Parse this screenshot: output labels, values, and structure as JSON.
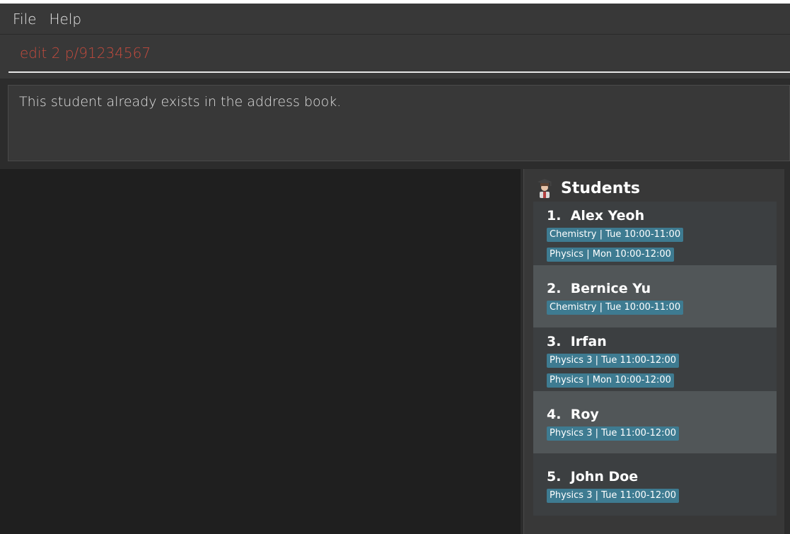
{
  "menu": {
    "items": [
      "File",
      "Help"
    ]
  },
  "command": {
    "value": "edit 2 p/91234567"
  },
  "result": {
    "message": "This student already exists in the address book."
  },
  "students": {
    "title": "Students",
    "icon": "student-graduate-icon",
    "list": [
      {
        "index": "1.",
        "name": "Alex Yeoh",
        "tags": [
          "Chemistry | Tue 10:00-11:00",
          "Physics | Mon 10:00-12:00"
        ]
      },
      {
        "index": "2.",
        "name": "Bernice Yu",
        "tags": [
          "Chemistry | Tue 10:00-11:00"
        ]
      },
      {
        "index": "3.",
        "name": "Irfan",
        "tags": [
          "Physics 3 | Tue 11:00-12:00",
          "Physics | Mon 10:00-12:00"
        ]
      },
      {
        "index": "4.",
        "name": "Roy",
        "tags": [
          "Physics 3 | Tue 11:00-12:00"
        ]
      },
      {
        "index": "5.",
        "name": "John Doe",
        "tags": [
          "Physics 3 | Tue 11:00-12:00"
        ]
      }
    ]
  },
  "colors": {
    "command_text": "#c44b3e",
    "tag_bg": "#3e7b91",
    "card_odd": "#3c3f41",
    "card_even": "#515658"
  }
}
